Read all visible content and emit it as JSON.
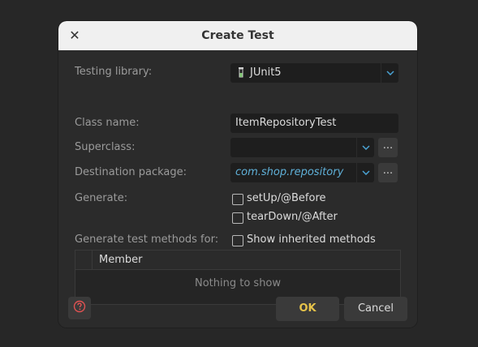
{
  "dialog": {
    "title": "Create Test",
    "close_icon": "close-icon"
  },
  "form": {
    "testing_library": {
      "label": "Testing library:",
      "value": "JUnit5",
      "icon": "test-tube-icon"
    },
    "class_name": {
      "label": "Class name:",
      "value": "ItemRepositoryTest"
    },
    "superclass": {
      "label": "Superclass:",
      "value": "",
      "browse_label": "..."
    },
    "destination_package": {
      "label": "Destination package:",
      "value": "com.shop.repository",
      "browse_label": "..."
    },
    "generate": {
      "label": "Generate:",
      "options": [
        {
          "label": "setUp/@Before",
          "checked": false
        },
        {
          "label": "tearDown/@After",
          "checked": false
        }
      ]
    },
    "generate_methods": {
      "label": "Generate test methods for:",
      "show_inherited": {
        "label": "Show inherited methods",
        "checked": false
      }
    }
  },
  "table": {
    "column_header": "Member",
    "empty_text": "Nothing to show"
  },
  "footer": {
    "help_icon": "help-icon",
    "ok_label": "OK",
    "cancel_label": "Cancel"
  },
  "colors": {
    "accent_ok": "#e6c34a",
    "package_text": "#5fb0d8",
    "help_icon": "#e05252",
    "junit_icon": "#7cc56f"
  }
}
